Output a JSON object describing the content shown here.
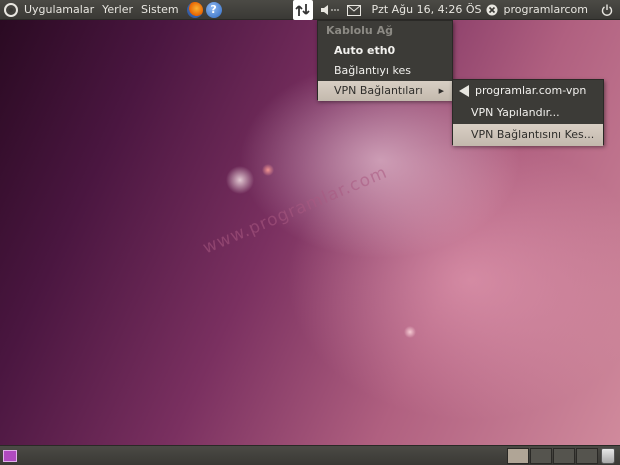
{
  "top_panel": {
    "menu_applications": "Uygulamalar",
    "menu_places": "Yerler",
    "menu_system": "Sistem",
    "clock": "Pzt Ağu 16,  4:26 ÖS",
    "username": "programlarcom"
  },
  "network_menu": {
    "section_header": "Kablolu Ağ",
    "connection": "Auto eth0",
    "disconnect": "Bağlantıyı kes",
    "vpn_connections": "VPN Bağlantıları"
  },
  "vpn_submenu": {
    "vpn_name": "programlar.com-vpn",
    "configure": "VPN Yapılandır...",
    "disconnect_vpn": "VPN Bağlantısını Kes..."
  },
  "watermark": "www.programlar.com",
  "icons": {
    "ubuntu": "ubuntu-logo-icon",
    "firefox": "firefox-icon",
    "help": "help-icon",
    "network": "network-icon",
    "volume": "volume-icon",
    "mail": "mail-icon",
    "power": "power-icon",
    "trash": "trash-icon"
  },
  "colors": {
    "panel": "#3c3b37",
    "menu_highlight": "#c3b9ad",
    "desktop_accent": "#7a3060"
  }
}
